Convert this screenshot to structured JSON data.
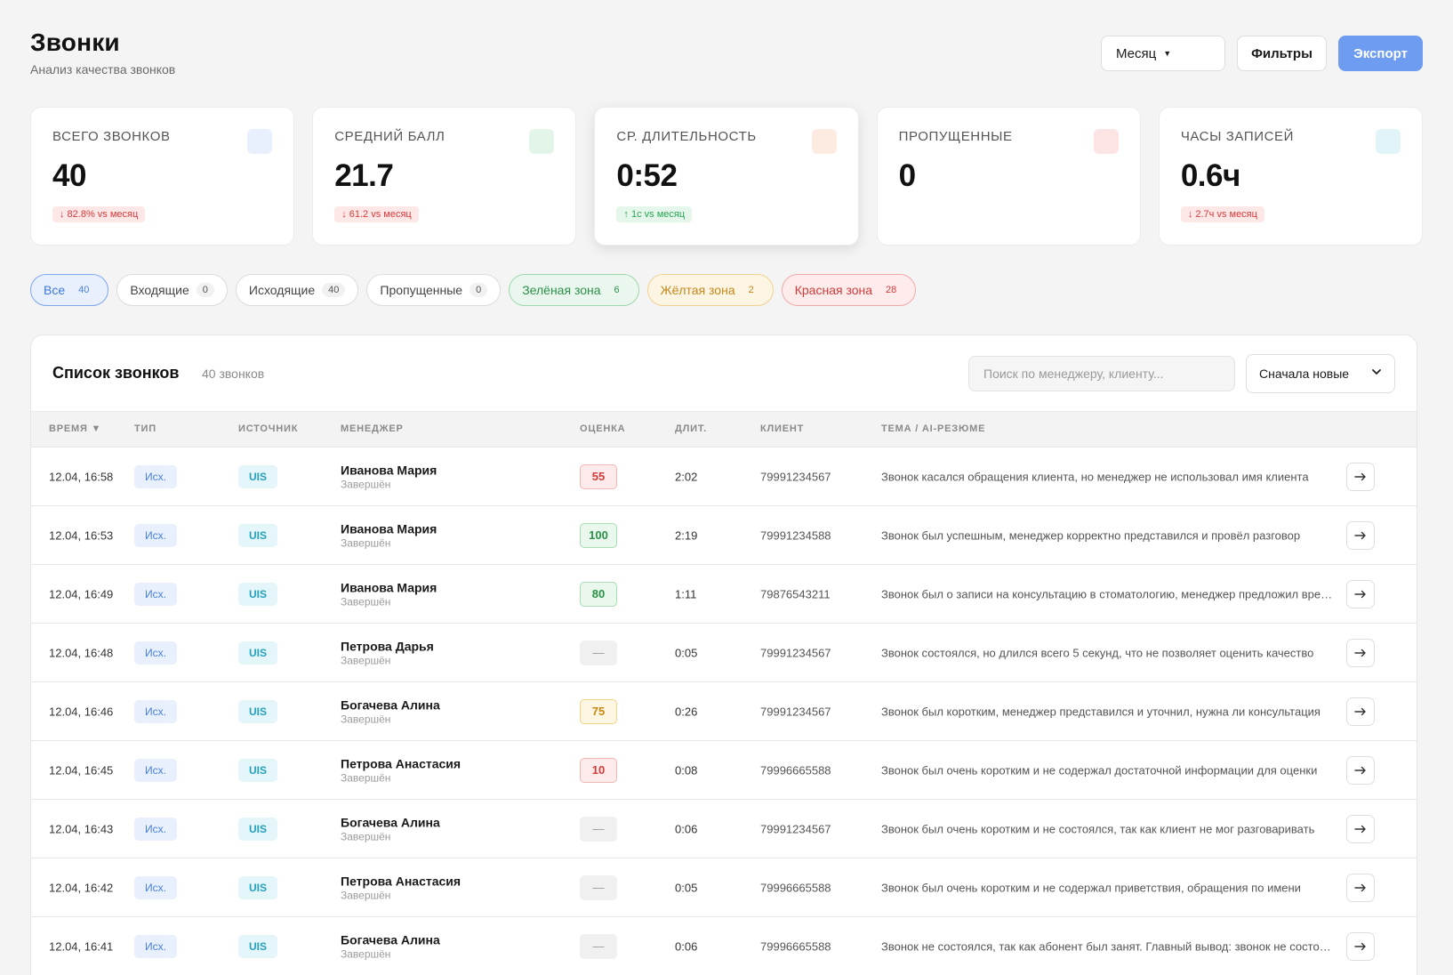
{
  "header": {
    "title": "Звонки",
    "subtitle": "Анализ качества звонков",
    "period_label": "Месяц",
    "filters_label": "Фильтры",
    "export_label": "Экспорт"
  },
  "stats": [
    {
      "label": "Всего звонков",
      "value": "40",
      "delta": "↓ 82.8% vs месяц",
      "delta_dir": "down",
      "accent": "#e8effd"
    },
    {
      "label": "Средний балл",
      "value": "21.7",
      "delta": "↓ 61.2 vs месяц",
      "delta_dir": "down",
      "accent": "#e3f5e8"
    },
    {
      "label": "Ср. длительность",
      "value": "0:52",
      "delta": "↑ 1с vs месяц",
      "delta_dir": "up",
      "accent": "#fdebe1"
    },
    {
      "label": "Пропущенные",
      "value": "0",
      "delta": "",
      "delta_dir": "",
      "accent": "#fde4e4"
    },
    {
      "label": "Часы записей",
      "value": "0.6ч",
      "delta": "↓ 2.7ч vs месяц",
      "delta_dir": "down",
      "accent": "#e1f5f9"
    }
  ],
  "chips": [
    {
      "label": "Все",
      "count": "40",
      "style": "active"
    },
    {
      "label": "Входящие",
      "count": "0",
      "style": ""
    },
    {
      "label": "Исходящие",
      "count": "40",
      "style": ""
    },
    {
      "label": "Пропущенные",
      "count": "0",
      "style": ""
    },
    {
      "label": "Зелёная зона",
      "count": "6",
      "style": "green"
    },
    {
      "label": "Жёлтая зона",
      "count": "2",
      "style": "yellow"
    },
    {
      "label": "Красная зона",
      "count": "28",
      "style": "red"
    }
  ],
  "list": {
    "title": "Список звонков",
    "count": "40 звонков",
    "search_placeholder": "Поиск по менеджеру, клиенту...",
    "sort_label": "Сначала новые"
  },
  "columns": {
    "time": "Время ▼",
    "type": "Тип",
    "source": "Источник",
    "manager": "Менеджер",
    "score": "Оценка",
    "duration": "Длит.",
    "client": "Клиент",
    "topic": "Тема / AI-резюме"
  },
  "rows": [
    {
      "time": "12.04, 16:58",
      "type": "Исх.",
      "source": "UIS",
      "manager": "Иванова Мария",
      "status": "Завершён",
      "score": "55",
      "score_zone": "red",
      "duration": "2:02",
      "client": "79991234567",
      "topic": "Звонок касался обращения клиента, но менеджер не использовал имя клиента"
    },
    {
      "time": "12.04, 16:53",
      "type": "Исх.",
      "source": "UIS",
      "manager": "Иванова Мария",
      "status": "Завершён",
      "score": "100",
      "score_zone": "green",
      "duration": "2:19",
      "client": "79991234588",
      "topic": "Звонок был успешным, менеджер корректно представился и провёл разговор"
    },
    {
      "time": "12.04, 16:49",
      "type": "Исх.",
      "source": "UIS",
      "manager": "Иванова Мария",
      "status": "Завершён",
      "score": "80",
      "score_zone": "green",
      "duration": "1:11",
      "client": "79876543211",
      "topic": "Звонок был о записи на консультацию в стоматологию, менеджер предложил время"
    },
    {
      "time": "12.04, 16:48",
      "type": "Исх.",
      "source": "UIS",
      "manager": "Петрова Дарья",
      "status": "Завершён",
      "score": "—",
      "score_zone": "none",
      "duration": "0:05",
      "client": "79991234567",
      "topic": "Звонок состоялся, но длился всего 5 секунд, что не позволяет оценить качество"
    },
    {
      "time": "12.04, 16:46",
      "type": "Исх.",
      "source": "UIS",
      "manager": "Богачева Алина",
      "status": "Завершён",
      "score": "75",
      "score_zone": "yellow",
      "duration": "0:26",
      "client": "79991234567",
      "topic": "Звонок был коротким, менеджер представился и уточнил, нужна ли консультация"
    },
    {
      "time": "12.04, 16:45",
      "type": "Исх.",
      "source": "UIS",
      "manager": "Петрова Анастасия",
      "status": "Завершён",
      "score": "10",
      "score_zone": "red",
      "duration": "0:08",
      "client": "79996665588",
      "topic": "Звонок был очень коротким и не содержал достаточной информации для оценки"
    },
    {
      "time": "12.04, 16:43",
      "type": "Исх.",
      "source": "UIS",
      "manager": "Богачева Алина",
      "status": "Завершён",
      "score": "—",
      "score_zone": "none",
      "duration": "0:06",
      "client": "79991234567",
      "topic": "Звонок был очень коротким и не состоялся, так как клиент не мог разговаривать"
    },
    {
      "time": "12.04, 16:42",
      "type": "Исх.",
      "source": "UIS",
      "manager": "Петрова Анастасия",
      "status": "Завершён",
      "score": "—",
      "score_zone": "none",
      "duration": "0:05",
      "client": "79996665588",
      "topic": "Звонок был очень коротким и не содержал приветствия, обращения по имени"
    },
    {
      "time": "12.04, 16:41",
      "type": "Исх.",
      "source": "UIS",
      "manager": "Богачева Алина",
      "status": "Завершён",
      "score": "—",
      "score_zone": "none",
      "duration": "0:06",
      "client": "79996665588",
      "topic": "Звонок не состоялся, так как абонент был занят. Главный вывод: звонок не состоялся"
    }
  ]
}
